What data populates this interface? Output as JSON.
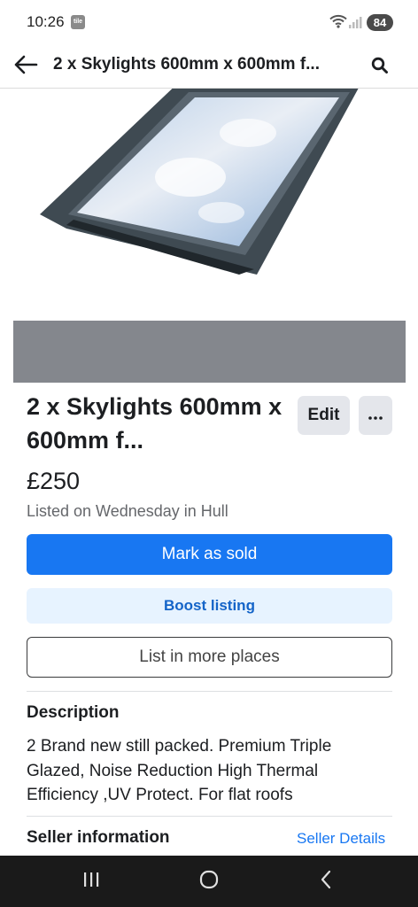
{
  "status_bar": {
    "time": "10:26",
    "app_icon_label": "tile",
    "battery": "84"
  },
  "header": {
    "title": "2 x Skylights 600mm x 600mm f..."
  },
  "listing": {
    "title": "2 x Skylights 600mm x 600mm f...",
    "price": "£250",
    "listed_info": "Listed on Wednesday in Hull",
    "edit_label": "Edit"
  },
  "actions": {
    "mark_sold": "Mark as sold",
    "boost": "Boost listing",
    "list_more": "List in more places"
  },
  "description": {
    "heading": "Description",
    "body": "2 Brand new still packed. Premium Triple Glazed, Noise Reduction High Thermal Efficiency ,UV Protect. For flat roofs"
  },
  "seller": {
    "heading": "Seller information",
    "link": "Seller Details"
  },
  "colors": {
    "primary": "#1877f2",
    "boost_bg": "#e7f3ff",
    "secondary_button": "#e4e6eb",
    "nav_bar": "#1a1a1a"
  },
  "icons": {
    "back": "back-arrow-icon",
    "search": "search-icon",
    "more": "more-horizontal-icon",
    "nav_recents": "recents-icon",
    "nav_home": "home-icon",
    "nav_back": "back-chevron-icon"
  }
}
